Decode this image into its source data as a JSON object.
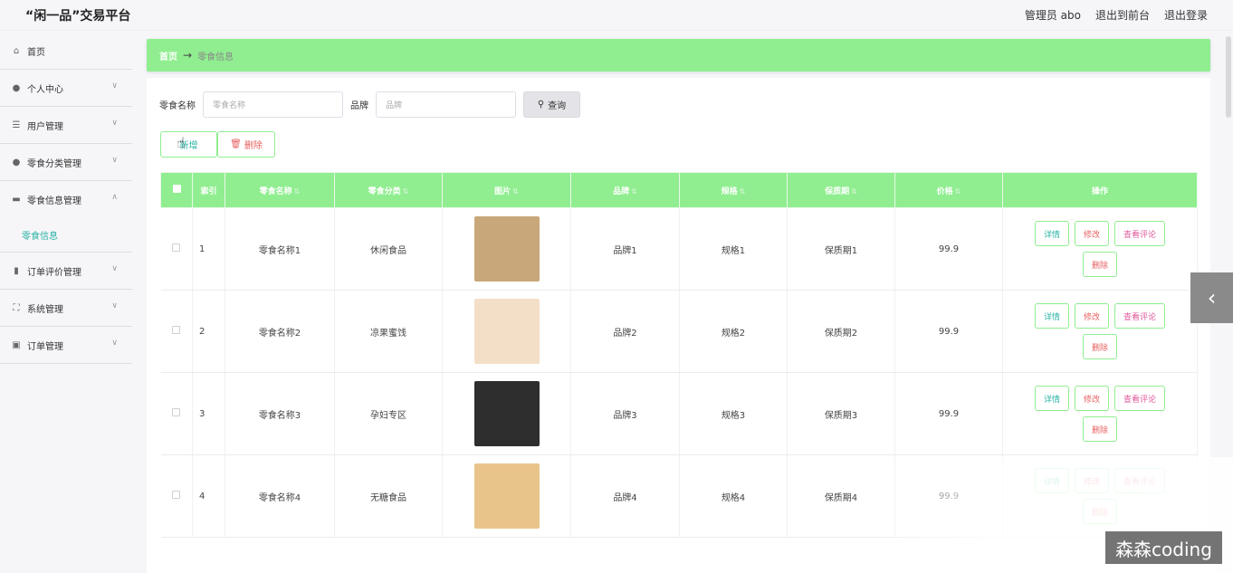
{
  "app": {
    "title": "“闲一品”交易平台",
    "admin_label": "管理员 abo",
    "to_front": "退出到前台",
    "logout": "退出登录"
  },
  "sidebar": {
    "items": [
      {
        "label": "首页",
        "icon": "home-icon",
        "glyph": "⌂",
        "has_chevron": false
      },
      {
        "label": "个人中心",
        "icon": "user-icon",
        "glyph": "●",
        "has_chevron": true
      },
      {
        "label": "用户管理",
        "icon": "list-icon",
        "glyph": "☰",
        "has_chevron": true
      },
      {
        "label": "零食分类管理",
        "icon": "user-icon",
        "glyph": "●",
        "has_chevron": true
      },
      {
        "label": "零食信息管理",
        "icon": "briefcase-icon",
        "glyph": "▬",
        "has_chevron": true,
        "expanded": true
      },
      {
        "label": "订单评价管理",
        "icon": "bar-chart-icon",
        "glyph": "▮",
        "has_chevron": true
      },
      {
        "label": "系统管理",
        "icon": "fullscreen-icon",
        "glyph": "⛶",
        "has_chevron": true
      },
      {
        "label": "订单管理",
        "icon": "clipboard-icon",
        "glyph": "▣",
        "has_chevron": true
      }
    ],
    "submenu_active": "零食信息"
  },
  "breadcrumb": {
    "home": "首页",
    "arrow": "→",
    "current": "零食信息"
  },
  "search": {
    "name_label": "零食名称",
    "name_placeholder": "零食名称",
    "brand_label": "品牌",
    "brand_placeholder": "品牌",
    "query_button": "查询",
    "query_icon": "search-icon"
  },
  "actions": {
    "add": "新增",
    "delete": "删除"
  },
  "table": {
    "headers": [
      "索引",
      "零食名称",
      "零食分类",
      "图片",
      "品牌",
      "规格",
      "保质期",
      "价格",
      "操作"
    ],
    "ops": {
      "detail": "详情",
      "edit": "修改",
      "comment": "查看评论",
      "remove": "删除"
    },
    "rows": [
      {
        "index": "1",
        "name": "零食名称1",
        "category": "休闲食品",
        "brand": "品牌1",
        "spec": "规格1",
        "shelf": "保质期1",
        "price": "99.9",
        "thumb_color": "#c8a77a"
      },
      {
        "index": "2",
        "name": "零食名称2",
        "category": "凉果蜜饯",
        "brand": "品牌2",
        "spec": "规格2",
        "shelf": "保质期2",
        "price": "99.9",
        "thumb_color": "#f3dfc7"
      },
      {
        "index": "3",
        "name": "零食名称3",
        "category": "孕妇专区",
        "brand": "品牌3",
        "spec": "规格3",
        "shelf": "保质期3",
        "price": "99.9",
        "thumb_color": "#2e2e2e"
      },
      {
        "index": "4",
        "name": "零食名称4",
        "category": "无糖食品",
        "brand": "品牌4",
        "spec": "规格4",
        "shelf": "保质期4",
        "price": "99.9",
        "thumb_color": "#e9c48a"
      }
    ]
  },
  "collapse_arrow": "‹",
  "watermark": "森森coding",
  "colors": {
    "accent": "#90ee90",
    "teal": "#2bb3a4",
    "danger": "#e86060"
  }
}
